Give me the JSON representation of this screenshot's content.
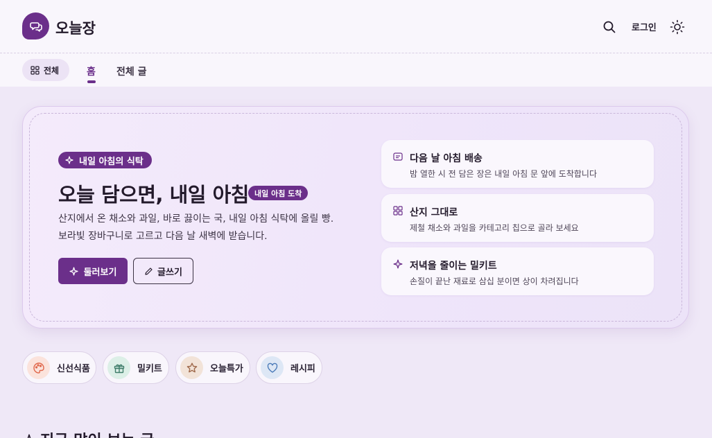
{
  "header": {
    "logo_text": "오늘장",
    "login_label": "로그인"
  },
  "subnav": {
    "all_label": "전체",
    "tabs": [
      {
        "label": "홈",
        "active": true
      },
      {
        "label": "전체 글",
        "active": false
      }
    ]
  },
  "hero": {
    "badge": "내일 아침의 식탁",
    "title": "오늘 담으면, 내일 아침",
    "title_pill": "내일 아침 도착",
    "description_lines": [
      "산지에서 온 채소와 과일, 바로 끓이는 국, 내일 아침 식탁에 올릴 빵.",
      "보라빛 장바구니로 고르고 다음 날 새벽에 받습니다."
    ],
    "primary_button": "둘러보기",
    "secondary_button": "글쓰기",
    "features": [
      {
        "icon": "card-icon",
        "title": "다음 날 아침 배송",
        "desc": "밤 열한 시 전 담은 장은 내일 아침 문 앞에 도착합니다"
      },
      {
        "icon": "grid-icon",
        "title": "산지 그대로",
        "desc": "제철 채소와 과일을 카테고리 칩으로 골라 보세요"
      },
      {
        "icon": "sparkle-icon",
        "title": "저녁을 줄이는 밀키트",
        "desc": "손질이 끝난 재료로 삼십 분이면 상이 차려집니다"
      }
    ]
  },
  "categories": [
    {
      "label": "신선식품",
      "icon": "palette-icon",
      "color": "#e0664a",
      "bg": "#fbe3dc"
    },
    {
      "label": "밀키트",
      "icon": "gift-icon",
      "color": "#3f7d6a",
      "bg": "#dcefe7"
    },
    {
      "label": "오늘특가",
      "icon": "star-icon",
      "color": "#a06a4c",
      "bg": "#f2e3d8"
    },
    {
      "label": "레시피",
      "icon": "heart-icon",
      "color": "#4a7ab8",
      "bg": "#dde7f5"
    }
  ],
  "section": {
    "title": "지금 많이 보는 글"
  },
  "colors": {
    "accent": "#6b2f8a",
    "background": "#efe8f7",
    "header_bg": "#f9f6fc"
  }
}
